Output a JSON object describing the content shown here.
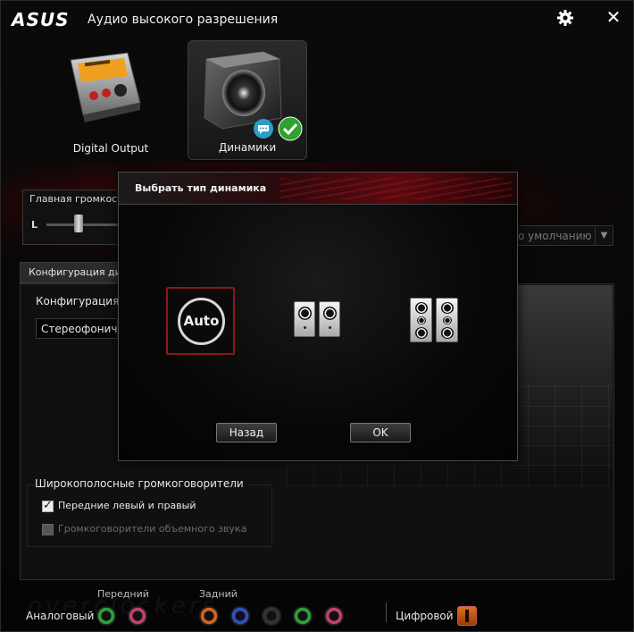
{
  "window": {
    "brand": "ASUS",
    "title": "Аудио высокого разрешения",
    "icons": {
      "settings": "gear-icon",
      "close": "close-icon"
    }
  },
  "devices": [
    {
      "label": "Digital Output",
      "selected": false,
      "icon": "digital-output-icon"
    },
    {
      "label": "Динамики",
      "selected": true,
      "icon": "speaker-icon"
    }
  ],
  "main_volume": {
    "title": "Главная громкость",
    "left_label": "L"
  },
  "default_device": {
    "text": "о умолчанию"
  },
  "config": {
    "tab_label": "Конфигурация динамиков",
    "sub_title": "Конфигурация д",
    "select_value": "Стереофонический",
    "wideband_title": "Широкополосные громкоговорители",
    "checkboxes": [
      {
        "label": "Передние левый и правый",
        "checked": true,
        "enabled": true
      },
      {
        "label": "Громкоговорители объемного звука",
        "checked": false,
        "enabled": false
      }
    ]
  },
  "jacks": {
    "analog_label": "Аналоговый",
    "front_label": "Передний",
    "rear_label": "Задний",
    "digital_label": "Цифровой",
    "colors": {
      "green": "#2e9e3a",
      "pink": "#c0406a",
      "orange": "#d2641e",
      "blue": "#2f4fc0",
      "black": "#333333"
    }
  },
  "dialog": {
    "title": "Выбрать тип динамика",
    "options": [
      "Auto",
      "stereo-speakers-icon",
      "surround-speakers-icon"
    ],
    "auto_label": "Auto",
    "back_button": "Назад",
    "ok_button": "OK",
    "accent": "#8a1a1a"
  }
}
